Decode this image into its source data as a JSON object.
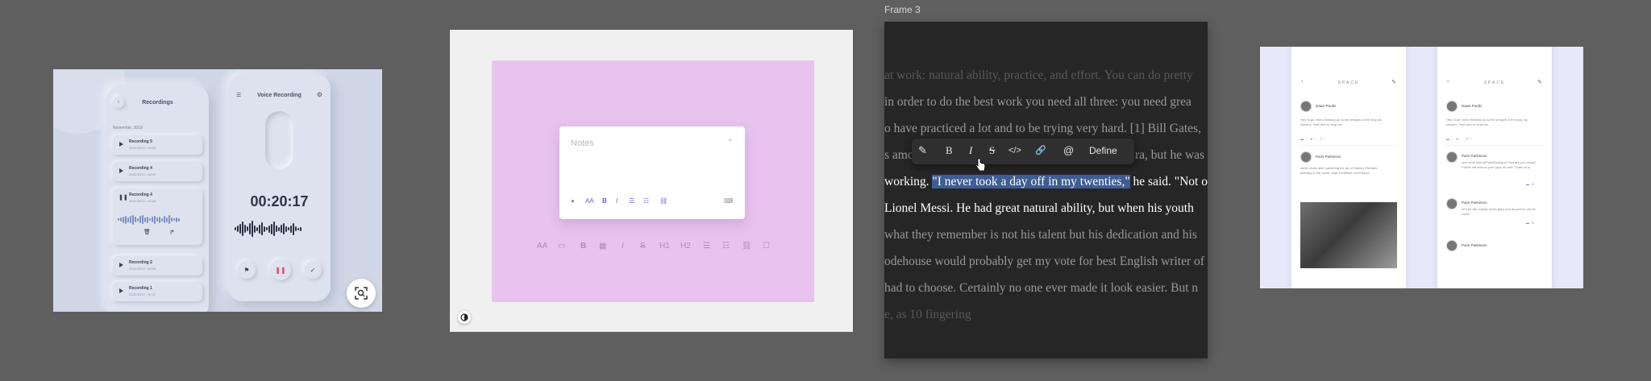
{
  "frame1": {
    "left_phone": {
      "title": "Recordings",
      "month": "November, 2019",
      "recordings": [
        {
          "name": "Recording 5",
          "date": "20/11/2019 · 00:43"
        },
        {
          "name": "Recording 4",
          "date": "20/11/2019 · 00:43"
        },
        {
          "name": "Recording 4",
          "date": "20/11/2019 · 00:43"
        },
        {
          "name": "Recording 2",
          "date": "21/11/2019 · 00:28"
        },
        {
          "name": "Recording 1",
          "date": "21/11/2019 · 00:22"
        }
      ]
    },
    "right_phone": {
      "title": "Voice Recording",
      "timer": "00:20:17"
    },
    "icons": [
      "back-icon",
      "menu-icon",
      "settings-icon",
      "play-icon",
      "pause-icon",
      "trash-icon",
      "share-icon",
      "flag-icon",
      "check-icon",
      "capture-icon"
    ]
  },
  "frame2": {
    "notes_placeholder": "Notes",
    "card_toolbar": [
      "●",
      "AA",
      "B",
      "I",
      "☰",
      "☷",
      "⛓",
      "⌨"
    ],
    "bottom_toolbar": [
      "AA",
      "▭",
      "B",
      "▦",
      "I",
      "S",
      "H1",
      "H2",
      "☰",
      "☷",
      "⛓",
      "☐"
    ]
  },
  "frame3": {
    "label": "Frame 3",
    "lines": [
      "at work: natural ability, practice, and effort. You can do pretty",
      "in order to do the best work you need all three: you need grea",
      "o have practiced a lot and to be trying very hard. [1] Bill Gates,",
      "s amo",
      "ra, but he was",
      "working.",
      "\"I never took a day off in my twenties,\"",
      "he said. \"Not o",
      "Lionel Messi. He had great natural ability, but when his youth",
      "what they remember is not his talent but his dedication and his",
      "odehouse would probably get my vote for best English writer of",
      "had to choose. Certainly no one ever made it look easier. But n",
      "e, as 10 fingering"
    ],
    "toolbar": {
      "highlight": "✎",
      "bold": "B",
      "italic": "I",
      "strike": "S",
      "code": "</>",
      "link": "🔗",
      "mention": "@",
      "define": "Define"
    }
  },
  "frame4": {
    "header": "SPACE",
    "left_feed": {
      "post1_user": "Dawn Poultz",
      "post1_text": "Hey Guys, been thinking up some designs in the shop as stickers. Feel free to drop me.",
      "post2_user": "Paris Parkinson",
      "post2_text": "some shots and i gathering the art of Stanley Portraits birthday in the hams: https://dribbble.com/Shoz3"
    },
    "right_feed": {
      "post1_user": "Dawn Poultz",
      "post1_text": "Hey Guys, been thinking up some designs in the shop as stickers. Feel free to drop me.",
      "replies": [
        {
          "user": "Paris Parkinson",
          "text": "love work with @PaulsDesigns! How are you doing? Follow me and on your guys as well. Chart on is."
        },
        {
          "user": "Paris Parkinson",
          "text": "and for the orange touch grips just as part as are all vision"
        },
        {
          "user": "Paris Parkinson",
          "text": ""
        }
      ]
    }
  }
}
